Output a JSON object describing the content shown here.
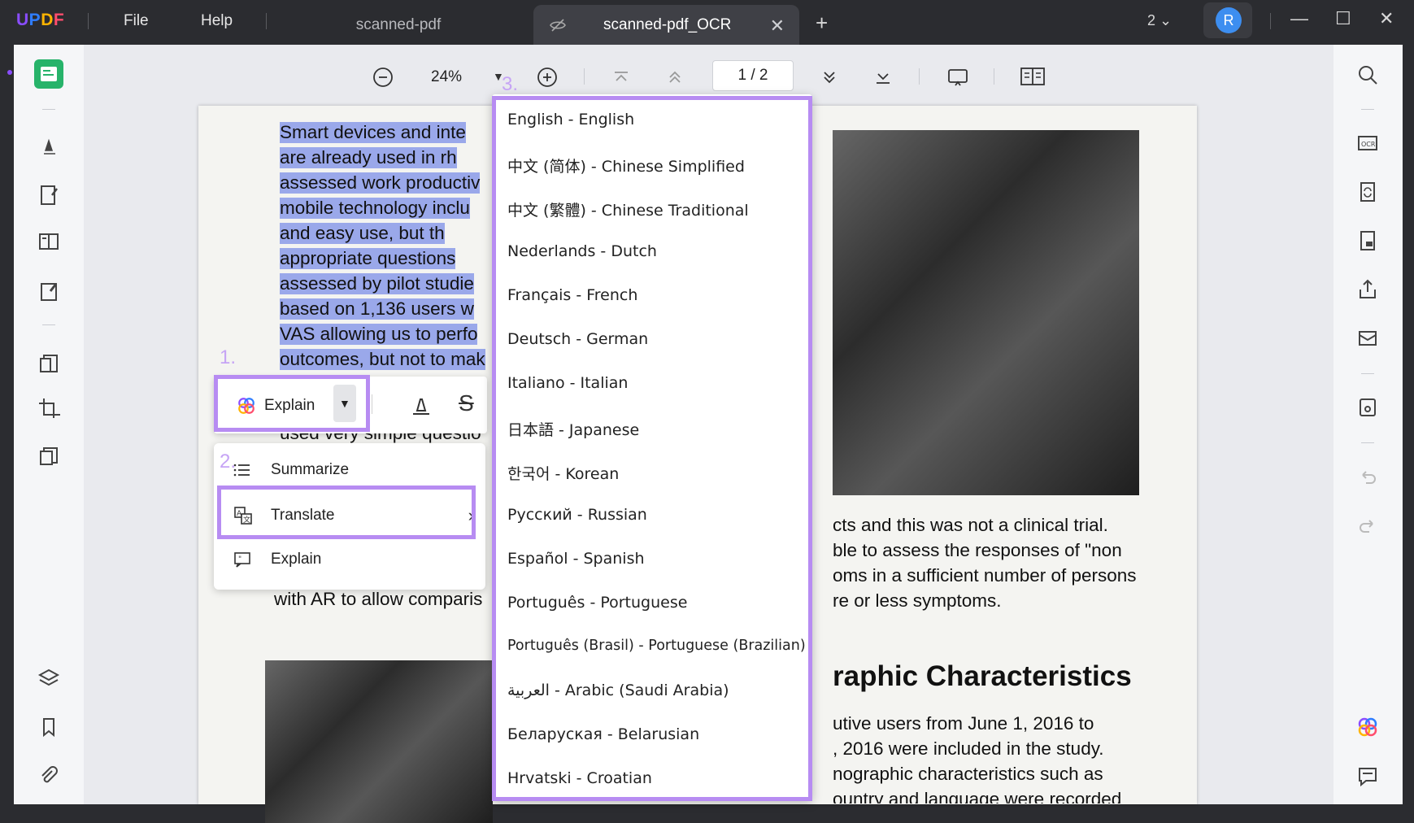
{
  "app": {
    "logo": "UPDF",
    "menu": [
      "File",
      "Help"
    ],
    "tabs": [
      {
        "label": "scanned-pdf",
        "active": false
      },
      {
        "label": "scanned-pdf_OCR",
        "active": true
      }
    ],
    "window_count": "2",
    "avatar_letter": "R",
    "accent_color": "#b78cf2"
  },
  "toolbar": {
    "zoom": "24%",
    "page_indicator": "1 / 2"
  },
  "document": {
    "highlighted_lines": [
      "Smart devices and inte",
      "are already used in rh",
      "assessed work productiv",
      "mobile technology inclu",
      "and easy use, but th",
      "appropriate questions",
      "assessed by pilot studie",
      "based on 1,136 users w",
      "VAS allowing us to perfo",
      "outcomes, but not to mak"
    ],
    "partial_line": "used very simple questio",
    "left_bottom_line": "with AR to allow comparis",
    "right_lines": [
      "cts and this was not a clinical trial.",
      "ble to assess the responses of \"non",
      "oms in a sufficient number of persons",
      "re or less symptoms."
    ],
    "section_title": "raphic Characteristics",
    "right_lines_2": [
      "utive users from June 1, 2016 to",
      ", 2016 were included in the study.",
      "nographic characteristics such as",
      "ountry and language were recorded"
    ]
  },
  "ai_popup": {
    "explain_label": "Explain",
    "steps": [
      "1.",
      "2.",
      "3."
    ],
    "submenu": [
      {
        "label": "Summarize",
        "icon": "list-icon"
      },
      {
        "label": "Translate",
        "icon": "translate-icon",
        "has_arrow": true
      },
      {
        "label": "Explain",
        "icon": "explain-icon"
      }
    ]
  },
  "languages": [
    "English - English",
    "中文 (简体) - Chinese Simplified",
    "中文 (繁體) - Chinese Traditional",
    "Nederlands - Dutch",
    "Français - French",
    "Deutsch - German",
    "Italiano - Italian",
    "日本語 - Japanese",
    "한국어 - Korean",
    "Русский - Russian",
    "Español - Spanish",
    "Português - Portuguese",
    "Português (Brasil) - Portuguese (Brazilian)",
    "العربية - Arabic (Saudi Arabia)",
    "Беларуская - Belarusian",
    "Hrvatski - Croatian"
  ]
}
